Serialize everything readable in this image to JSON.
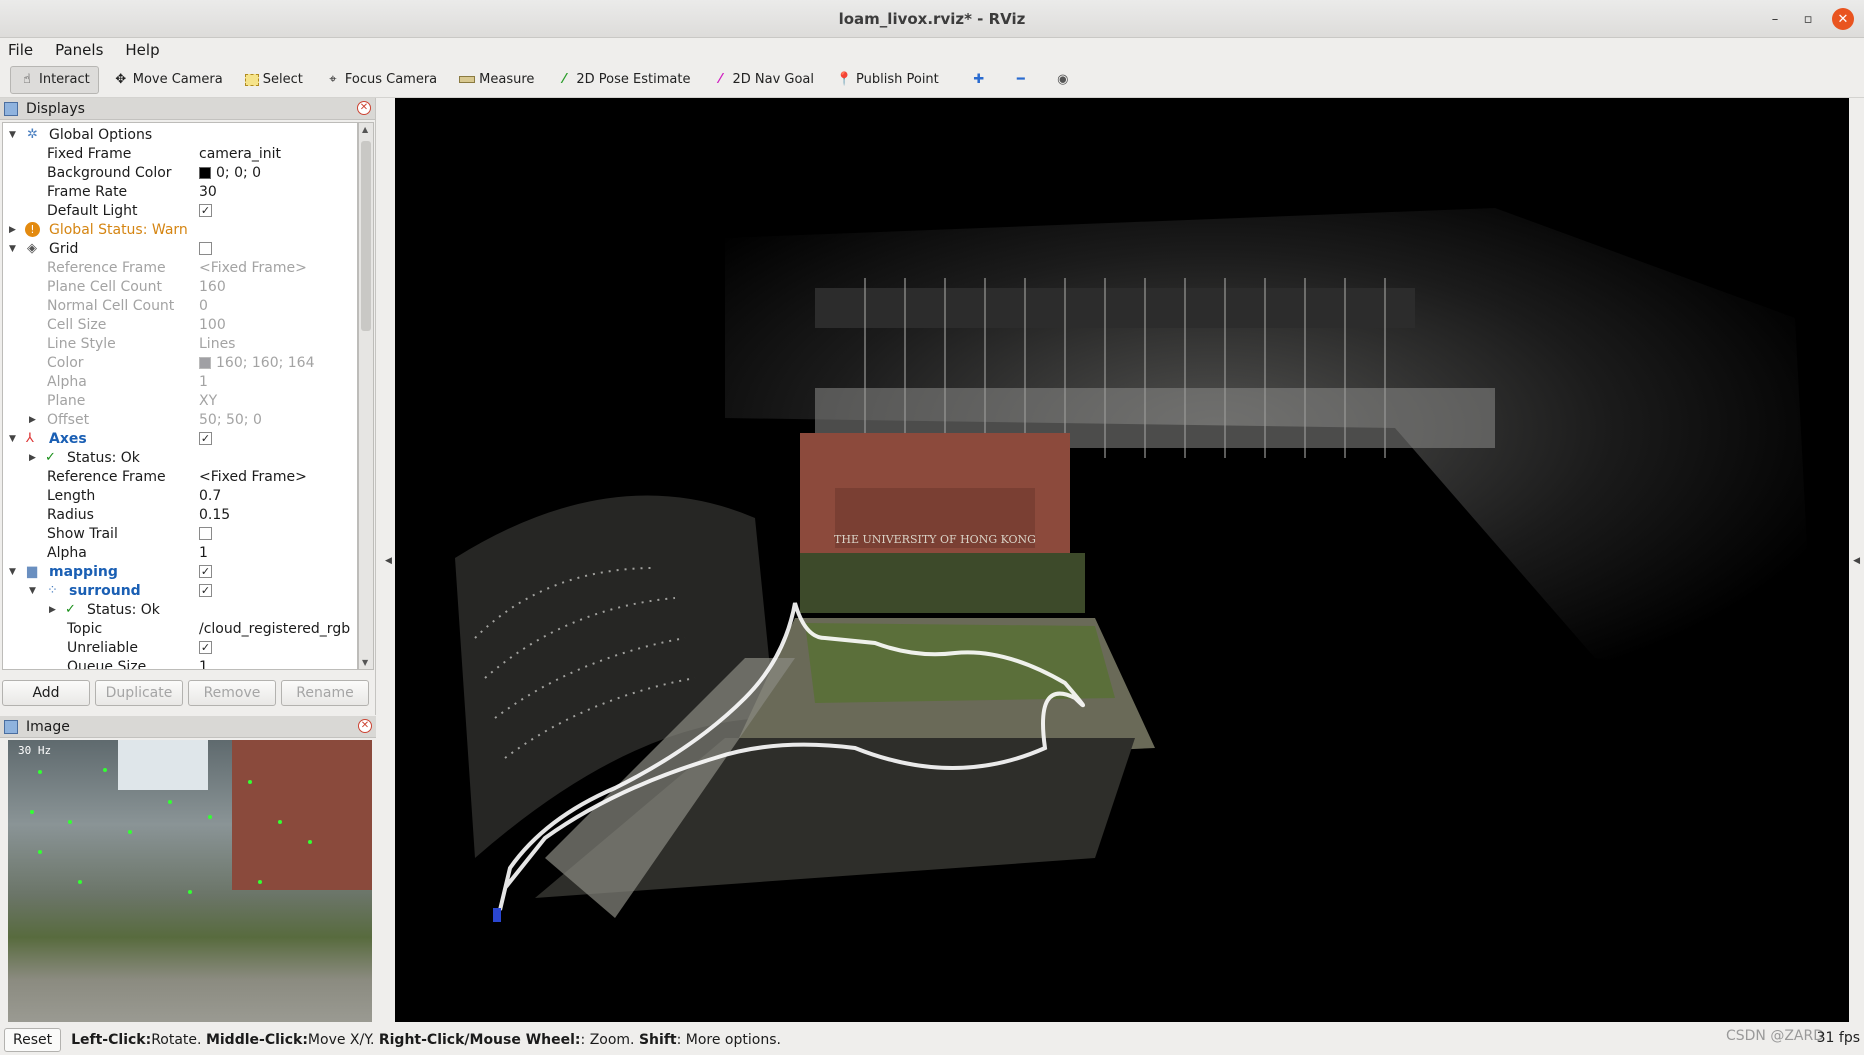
{
  "window": {
    "title": "loam_livox.rviz* - RViz",
    "minimize": "–",
    "maximize": "▫",
    "close": "✕"
  },
  "menu": {
    "file": "File",
    "panels": "Panels",
    "help": "Help"
  },
  "toolbar": {
    "interact": "Interact",
    "move_camera": "Move Camera",
    "select": "Select",
    "focus_camera": "Focus Camera",
    "measure": "Measure",
    "pose_estimate": "2D Pose Estimate",
    "nav_goal": "2D Nav Goal",
    "publish_point": "Publish Point"
  },
  "displays": {
    "title": "Displays",
    "rows": [
      {
        "label": "Global Options",
        "value": ""
      },
      {
        "label": "Fixed Frame",
        "value": "camera_init"
      },
      {
        "label": "Background Color",
        "value": "0; 0; 0",
        "swatch": "#000000"
      },
      {
        "label": "Frame Rate",
        "value": "30"
      },
      {
        "label": "Default Light",
        "value": "✓"
      },
      {
        "label": "Global Status: Warn",
        "value": ""
      },
      {
        "label": "Grid",
        "value": ""
      },
      {
        "label": "Reference Frame",
        "value": "<Fixed Frame>"
      },
      {
        "label": "Plane Cell Count",
        "value": "160"
      },
      {
        "label": "Normal Cell Count",
        "value": "0"
      },
      {
        "label": "Cell Size",
        "value": "100"
      },
      {
        "label": "Line Style",
        "value": "Lines"
      },
      {
        "label": "Color",
        "value": "160; 160; 164",
        "swatch": "#a0a0a4"
      },
      {
        "label": "Alpha",
        "value": "1"
      },
      {
        "label": "Plane",
        "value": "XY"
      },
      {
        "label": "Offset",
        "value": "50; 50; 0"
      },
      {
        "label": "Axes",
        "value": "✓"
      },
      {
        "label": "Status: Ok",
        "value": ""
      },
      {
        "label": "Reference Frame",
        "value": "<Fixed Frame>"
      },
      {
        "label": "Length",
        "value": "0.7"
      },
      {
        "label": "Radius",
        "value": "0.15"
      },
      {
        "label": "Show Trail",
        "value": ""
      },
      {
        "label": "Alpha",
        "value": "1"
      },
      {
        "label": "mapping",
        "value": "✓"
      },
      {
        "label": "surround",
        "value": "✓"
      },
      {
        "label": "Status: Ok",
        "value": ""
      },
      {
        "label": "Topic",
        "value": "/cloud_registered_rgb"
      },
      {
        "label": "Unreliable",
        "value": "✓"
      },
      {
        "label": "Queue Size",
        "value": "1"
      }
    ],
    "buttons": {
      "add": "Add",
      "duplicate": "Duplicate",
      "remove": "Remove",
      "rename": "Rename"
    }
  },
  "image_panel": {
    "title": "Image",
    "hz": "30 Hz"
  },
  "statusbar": {
    "reset": "Reset",
    "left_click": "Left-Click:",
    "left_click_desc": " Rotate. ",
    "middle_click": "Middle-Click:",
    "middle_click_desc": " Move X/Y. ",
    "right_click": "Right-Click/Mouse Wheel:",
    "right_click_desc": ": Zoom. ",
    "shift": "Shift",
    "shift_desc": ": More options.",
    "fps": "31 fps",
    "watermark": "CSDN @ZARD"
  },
  "scene": {
    "sign_text": "THE UNIVERSITY OF HONG KONG"
  }
}
